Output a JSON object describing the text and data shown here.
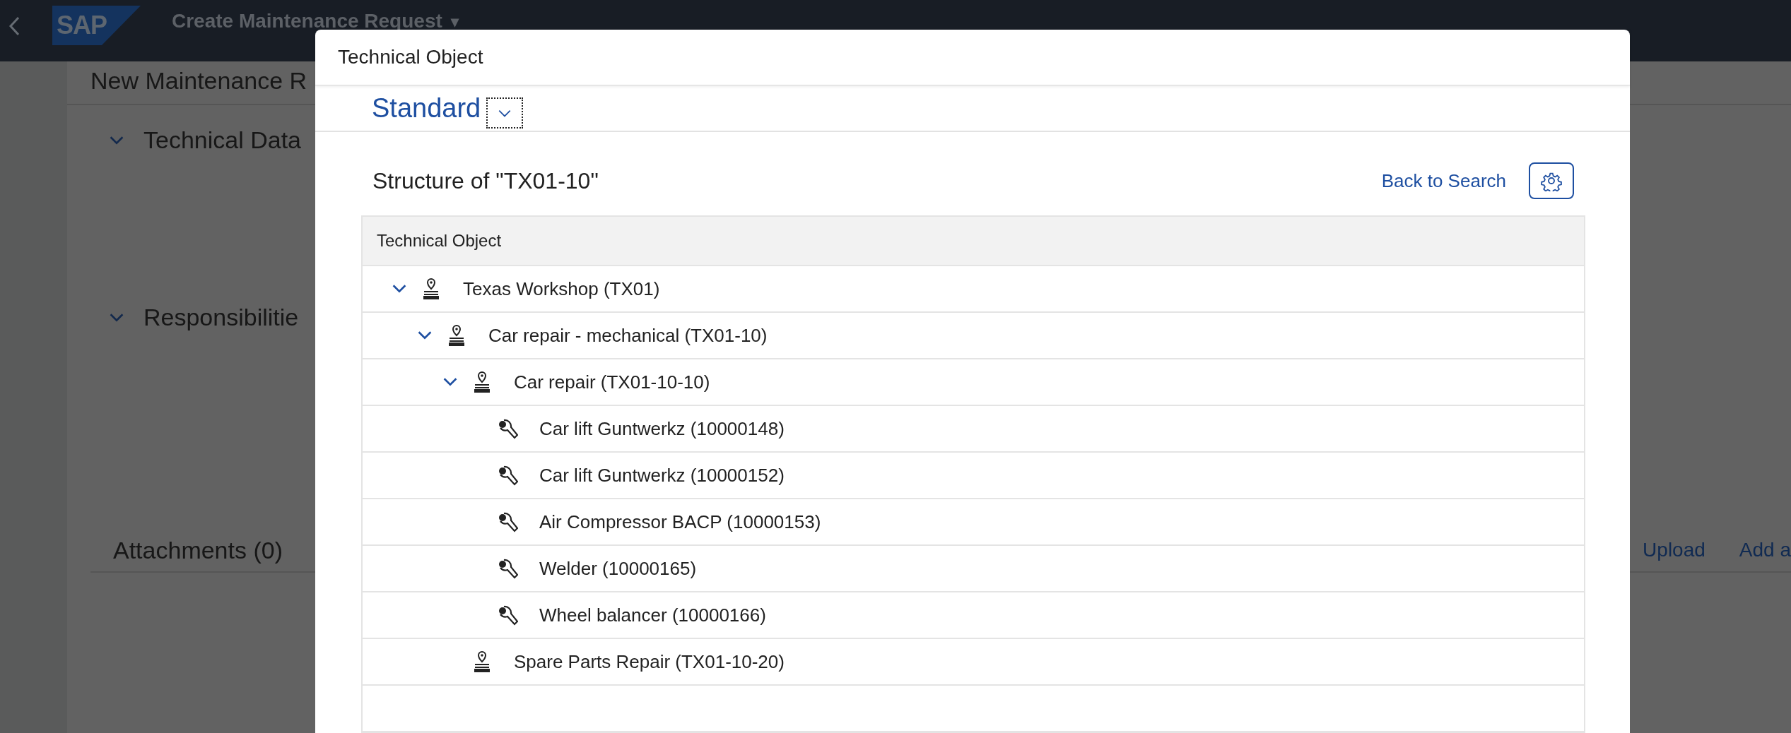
{
  "shell_bar": {
    "logo": "SAP",
    "title": "Create Maintenance Request",
    "title_menu": "▾"
  },
  "page": {
    "header": "New Maintenance R",
    "sections": [
      {
        "title": "Technical Data",
        "expanded": true
      },
      {
        "title": "Responsibilitie",
        "expanded": true
      }
    ],
    "attachments": {
      "title": "Attachments (0)",
      "actions": [
        "Upload",
        "Add a"
      ]
    }
  },
  "dialog": {
    "title": "Technical Object",
    "variant": "Standard",
    "structure_title": "Structure of \"TX01-10\"",
    "back_link": "Back to Search",
    "table": {
      "columns": [
        "Technical Object"
      ],
      "rows": [
        {
          "label": "Texas Workshop (TX01)",
          "kind": "functional_location",
          "expanded": true,
          "children": [
            {
              "label": "Car repair - mechanical (TX01-10)",
              "kind": "functional_location",
              "expanded": true,
              "children": [
                {
                  "label": "Car repair (TX01-10-10)",
                  "kind": "functional_location",
                  "expanded": true,
                  "children": [
                    {
                      "label": "Car lift Guntwerkz (10000148)",
                      "kind": "equipment"
                    },
                    {
                      "label": "Car lift Guntwerkz (10000152)",
                      "kind": "equipment"
                    },
                    {
                      "label": "Air Compressor BACP (10000153)",
                      "kind": "equipment"
                    },
                    {
                      "label": "Welder (10000165)",
                      "kind": "equipment"
                    },
                    {
                      "label": "Wheel balancer (10000166)",
                      "kind": "equipment"
                    }
                  ]
                },
                {
                  "label": "Spare Parts Repair (TX01-10-20)",
                  "kind": "functional_location"
                }
              ]
            }
          ]
        }
      ]
    }
  }
}
